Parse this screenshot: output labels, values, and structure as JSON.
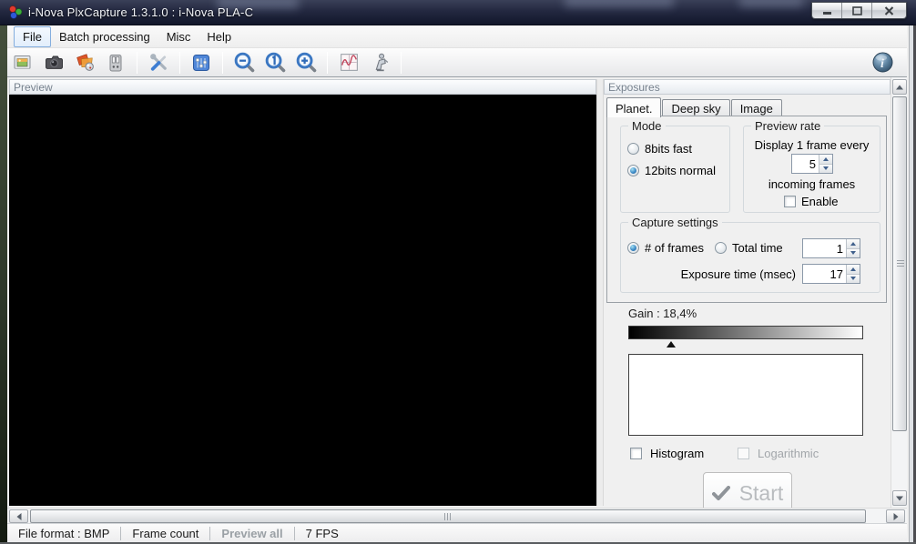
{
  "window": {
    "title": "i-Nova PlxCapture 1.3.1.0 : i-Nova PLA-C"
  },
  "menu": {
    "items": [
      {
        "label": "File",
        "highlighted": true
      },
      {
        "label": "Batch processing",
        "highlighted": false
      },
      {
        "label": "Misc",
        "highlighted": false
      },
      {
        "label": "Help",
        "highlighted": false
      }
    ]
  },
  "toolbar": {
    "icons": [
      "open-image",
      "camera",
      "color-adjust",
      "device-control",
      "tools",
      "control-panel",
      "zoom-out",
      "zoom-actual",
      "zoom-in",
      "histogram-curve",
      "autoguider",
      "info"
    ]
  },
  "preview": {
    "title": "Preview"
  },
  "exposures": {
    "title": "Exposures",
    "tabs": [
      {
        "label": "Planet.",
        "active": true
      },
      {
        "label": "Deep sky",
        "active": false
      },
      {
        "label": "Image",
        "active": false
      }
    ],
    "mode": {
      "label": "Mode",
      "radio_8bits": {
        "label": "8bits fast",
        "selected": false
      },
      "radio_12bits": {
        "label": "12bits normal",
        "selected": true
      }
    },
    "preview_rate": {
      "label": "Preview rate",
      "line1": "Display 1 frame every",
      "value": "5",
      "line2": "incoming frames",
      "enable": {
        "label": "Enable",
        "checked": false
      }
    },
    "capture": {
      "label": "Capture settings",
      "frames_radio": {
        "label": "# of frames",
        "selected": true
      },
      "total_radio": {
        "label": "Total time",
        "selected": false
      },
      "count_value": "1",
      "exposure_label": "Exposure time (msec)",
      "exposure_value": "17"
    },
    "gain": {
      "label": "Gain : 18,4%",
      "percent": 18.4
    },
    "histogram_checkbox": {
      "label": "Histogram",
      "checked": false
    },
    "logarithmic_checkbox": {
      "label": "Logarithmic",
      "checked": false,
      "disabled": true
    },
    "start": {
      "label": "Start"
    }
  },
  "statusbar": {
    "items": [
      "File format : BMP",
      "Frame count",
      "Preview all",
      "7 FPS"
    ]
  },
  "colors": {
    "titlebar": "#232840",
    "menu_highlight_border": "#84aede",
    "selection_blue": "#3f8cc8",
    "disabled_text": "#a2a6aa"
  }
}
